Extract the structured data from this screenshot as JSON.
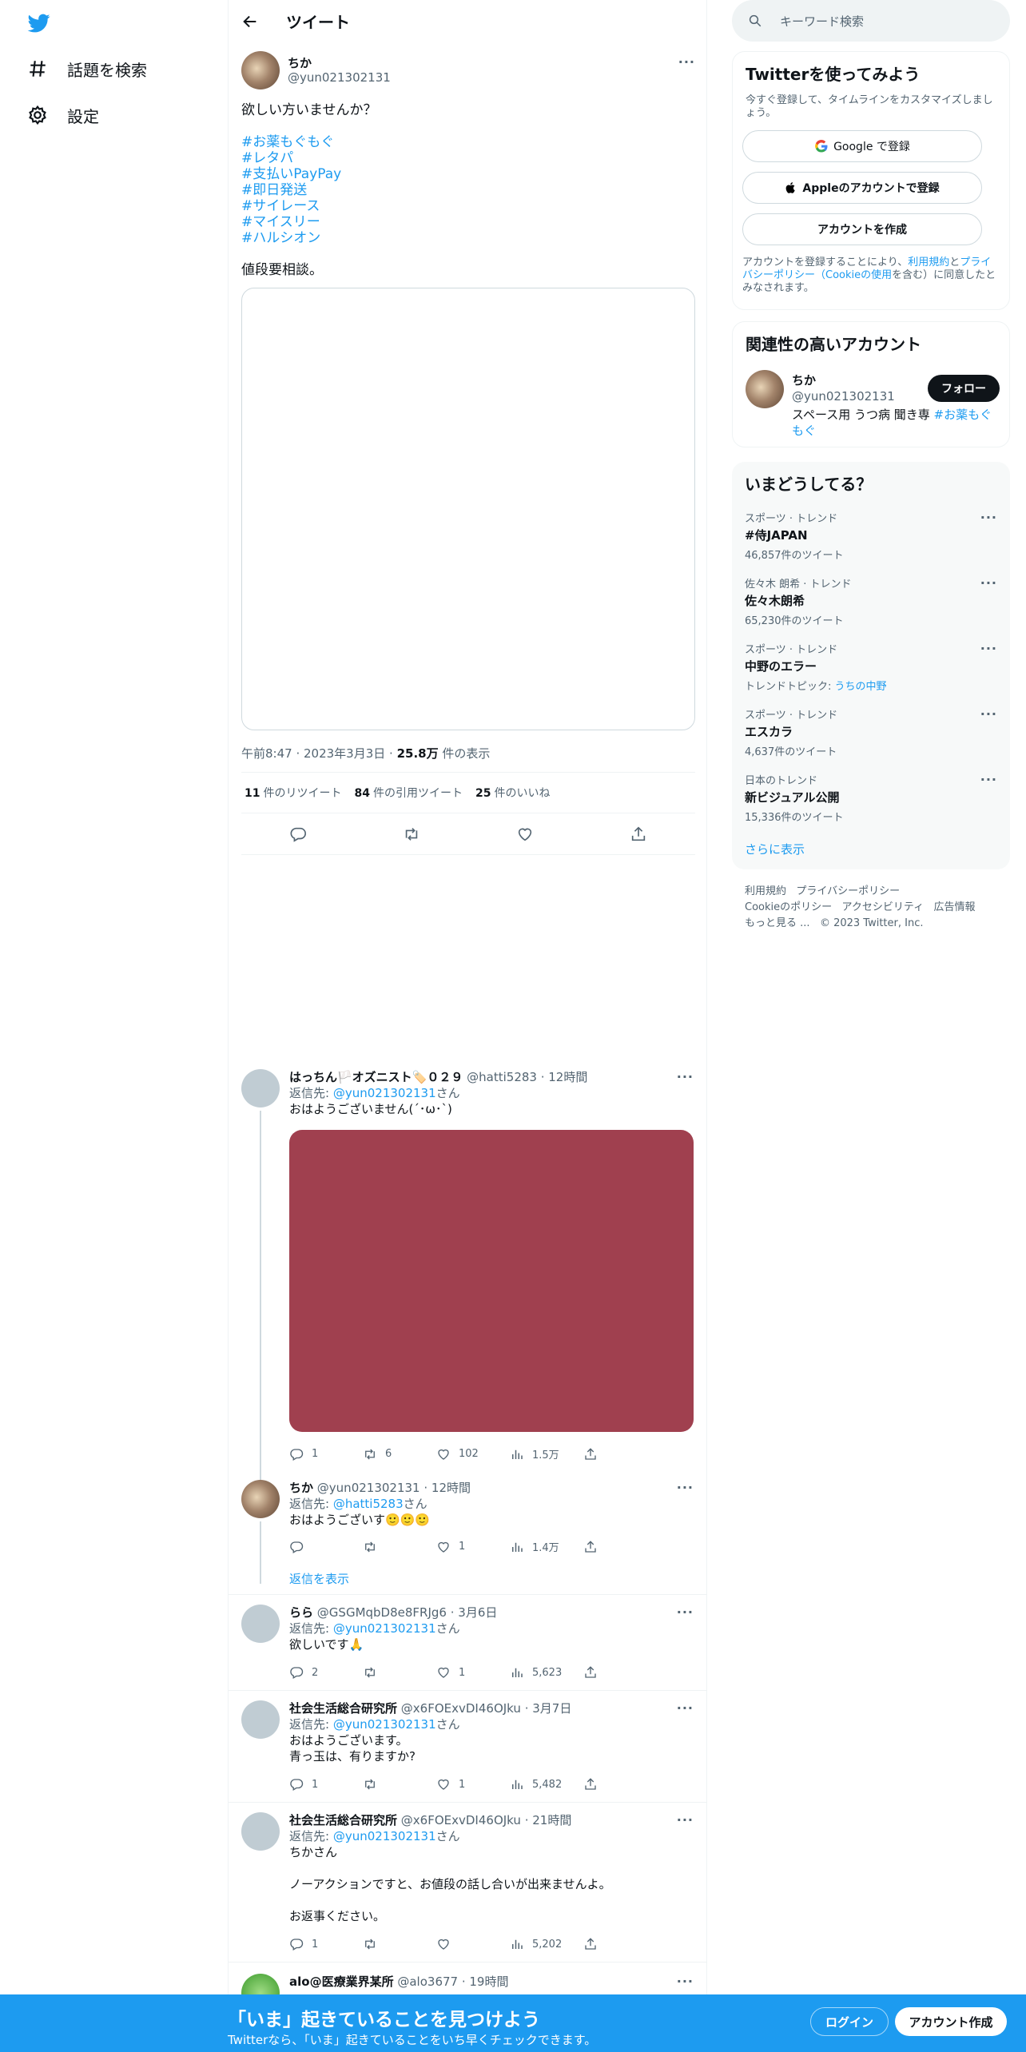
{
  "nav": {
    "explore": "話題を検索",
    "settings": "設定"
  },
  "header": {
    "title": "ツイート"
  },
  "tweet": {
    "name": "ちか",
    "handle": "@yun021302131",
    "text": "欲しい方いませんか？",
    "hashtags": [
      "#お薬もぐもぐ",
      "#レタパ",
      "#支払いPayPay",
      "#即日発送",
      "#サイレース",
      "#マイスリー",
      "#ハルシオン"
    ],
    "text2": "値段要相談。",
    "time": "午前8:47",
    "date": "2023年3月3日",
    "views": "25.8万",
    "views_label": "件の表示",
    "retweets": "11",
    "retweets_label": "件のリツイート",
    "quotes": "84",
    "quotes_label": "件の引用ツイート",
    "likes": "25",
    "likes_label": "件のいいね"
  },
  "replies": [
    {
      "name": "はっちん🏳️オズニスト🏷️０２９",
      "handle": "@hatti5283",
      "time": "12時間",
      "reply_to_label": "返信先:",
      "reply_to": "@yun021302131",
      "san": "さん",
      "text": "おはようございません(´･ω･`)",
      "reply_count": "1",
      "retweet_count": "6",
      "like_count": "102",
      "views": "1.5万"
    },
    {
      "name": "ちか",
      "handle": "@yun021302131",
      "time": "12時間",
      "reply_to_label": "返信先:",
      "reply_to": "@hatti5283",
      "san": "さん",
      "text": "おはようございす🙂🙂🙂",
      "reply_count": "",
      "retweet_count": "",
      "like_count": "1",
      "views": "1.4万",
      "show_replies": "返信を表示"
    },
    {
      "name": "らら",
      "handle": "@GSGMqbD8e8FRJg6",
      "time": "3月6日",
      "reply_to_label": "返信先:",
      "reply_to": "@yun021302131",
      "san": "さん",
      "text": "欲しいです🙏",
      "reply_count": "2",
      "retweet_count": "",
      "like_count": "1",
      "views": "5,623"
    },
    {
      "name": "社会生活総合研究所",
      "handle": "@x6FOExvDI46OJku",
      "time": "3月7日",
      "reply_to_label": "返信先:",
      "reply_to": "@yun021302131",
      "san": "さん",
      "text": "おはようございます。",
      "text2": "青っ玉は、有りますか?",
      "reply_count": "1",
      "retweet_count": "",
      "like_count": "1",
      "views": "5,482"
    },
    {
      "name": "社会生活総合研究所",
      "handle": "@x6FOExvDI46OJku",
      "time": "21時間",
      "reply_to_label": "返信先:",
      "reply_to": "@yun021302131",
      "san": "さん",
      "text": "ちかさん",
      "text2": "ノーアクションですと、お値段の話し合いが出来ませんよ。",
      "text3": "お返事ください。",
      "reply_count": "1",
      "retweet_count": "",
      "like_count": "",
      "views": "5,202"
    },
    {
      "name": "alo@医療業界某所",
      "handle": "@alo3677",
      "time": "19時間"
    }
  ],
  "search": {
    "placeholder": "キーワード検索"
  },
  "signup_card": {
    "title": "Twitterを使ってみよう",
    "subtitle": "今すぐ登録して、タイムラインをカスタマイズしましょう。",
    "google": "Google で登録",
    "apple": "Appleのアカウントで登録",
    "create": "アカウントを作成",
    "legal_1": "アカウントを登録することにより、",
    "legal_terms": "利用規約",
    "legal_and": "と",
    "legal_privacy": "プライバシーポリシー（Cookieの使用",
    "legal_2": "を含む）に同意したとみなされます。"
  },
  "related": {
    "title": "関連性の高いアカウント",
    "name": "ちか",
    "handle": "@yun021302131",
    "follow": "フォロー",
    "bio": "スペース用 うつ病 聞き専 ",
    "bio_tag": "#お薬もぐもぐ"
  },
  "trends": {
    "title": "いまどうしてる？",
    "items": [
      {
        "category": "スポーツ · トレンド",
        "topic": "#侍JAPAN",
        "count": "46,857件のツイート"
      },
      {
        "category": "佐々木 朗希 · トレンド",
        "topic": "佐々木朗希",
        "count": "65,230件のツイート"
      },
      {
        "category": "スポーツ · トレンド",
        "topic": "中野のエラー",
        "count_prefix": "トレンドトピック: ",
        "count_link": "うちの中野"
      },
      {
        "category": "スポーツ · トレンド",
        "topic": "エスカラ",
        "count": "4,637件のツイート"
      },
      {
        "category": "日本のトレンド",
        "topic": "新ビジュアル公開",
        "count": "15,336件のツイート"
      }
    ],
    "show_more": "さらに表示"
  },
  "footer": {
    "terms": "利用規約",
    "privacy": "プライバシーポリシー",
    "cookie": "Cookieのポリシー",
    "accessibility": "アクセシビリティ",
    "ads": "広告情報",
    "more": "もっと見る ...",
    "copyright": "© 2023 Twitter, Inc."
  },
  "bottom_bar": {
    "title": "「いま」起きていることを見つけよう",
    "subtitle": "Twitterなら、「いま」起きていることをいち早くチェックできます。",
    "login": "ログイン",
    "signup": "アカウント作成"
  },
  "colors": {
    "accent": "#1d9bf0",
    "text": "#0f1419",
    "secondary": "#536471",
    "media_placeholder": "#a0404f"
  }
}
